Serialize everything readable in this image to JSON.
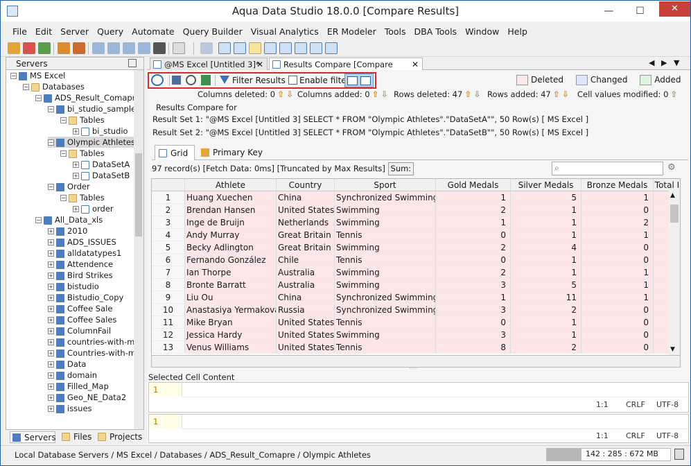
{
  "window": {
    "title": "Aqua Data Studio 18.0.0 [Compare Results]",
    "minimize": "—",
    "maximize": "☐",
    "close": "✕"
  },
  "menu": [
    "File",
    "Edit",
    "Server",
    "Query",
    "Automate",
    "Query Builder",
    "Visual Analytics",
    "ER Modeler",
    "Tools",
    "DBA Tools",
    "Window",
    "Help"
  ],
  "left_panel": {
    "title": "Servers",
    "tree": [
      {
        "label": "MS Excel",
        "depth": 0,
        "icon": "server-icon",
        "exp": "minus"
      },
      {
        "label": "Databases",
        "depth": 1,
        "icon": "folder-icon",
        "exp": "minus"
      },
      {
        "label": "ADS_Result_Comapre",
        "depth": 2,
        "icon": "database-icon",
        "exp": "minus"
      },
      {
        "label": "bi_studio_sample_",
        "depth": 3,
        "icon": "database-icon",
        "exp": "minus"
      },
      {
        "label": "Tables",
        "depth": 4,
        "icon": "folder-icon",
        "exp": "minus"
      },
      {
        "label": "bi_studio",
        "depth": 5,
        "icon": "table-icon",
        "exp": "plus"
      },
      {
        "label": "Olympic Athletes",
        "depth": 3,
        "icon": "database-icon",
        "exp": "minus",
        "selected": true
      },
      {
        "label": "Tables",
        "depth": 4,
        "icon": "folder-icon",
        "exp": "minus"
      },
      {
        "label": "DataSetA",
        "depth": 5,
        "icon": "table-icon",
        "exp": "plus"
      },
      {
        "label": "DataSetB",
        "depth": 5,
        "icon": "table-icon",
        "exp": "plus"
      },
      {
        "label": "Order",
        "depth": 3,
        "icon": "database-icon",
        "exp": "minus"
      },
      {
        "label": "Tables",
        "depth": 4,
        "icon": "folder-icon",
        "exp": "minus"
      },
      {
        "label": "order",
        "depth": 5,
        "icon": "table-icon",
        "exp": "plus"
      },
      {
        "label": "All_Data_xls",
        "depth": 2,
        "icon": "database-icon",
        "exp": "minus"
      },
      {
        "label": "2010",
        "depth": 3,
        "icon": "database-icon",
        "exp": "plus"
      },
      {
        "label": "ADS_ISSUES",
        "depth": 3,
        "icon": "database-icon",
        "exp": "plus"
      },
      {
        "label": "alldatatypes1",
        "depth": 3,
        "icon": "database-icon",
        "exp": "plus"
      },
      {
        "label": "Attendence",
        "depth": 3,
        "icon": "database-icon",
        "exp": "plus"
      },
      {
        "label": "Bird Strikes",
        "depth": 3,
        "icon": "database-icon",
        "exp": "plus"
      },
      {
        "label": "bistudio",
        "depth": 3,
        "icon": "database-icon",
        "exp": "plus"
      },
      {
        "label": "Bistudio_Copy",
        "depth": 3,
        "icon": "database-icon",
        "exp": "plus"
      },
      {
        "label": "Coffee Sale",
        "depth": 3,
        "icon": "database-icon",
        "exp": "plus"
      },
      {
        "label": "Coffee Sales",
        "depth": 3,
        "icon": "database-icon",
        "exp": "plus"
      },
      {
        "label": "ColumnFail",
        "depth": 3,
        "icon": "database-icon",
        "exp": "plus"
      },
      {
        "label": "countries-with-mo",
        "depth": 3,
        "icon": "database-icon",
        "exp": "plus"
      },
      {
        "label": "Countries-with-mo",
        "depth": 3,
        "icon": "database-icon",
        "exp": "plus"
      },
      {
        "label": "Data",
        "depth": 3,
        "icon": "database-icon",
        "exp": "plus"
      },
      {
        "label": "domain",
        "depth": 3,
        "icon": "database-icon",
        "exp": "plus"
      },
      {
        "label": "Filled_Map",
        "depth": 3,
        "icon": "database-icon",
        "exp": "plus"
      },
      {
        "label": "Geo_NE_Data2",
        "depth": 3,
        "icon": "database-icon",
        "exp": "plus"
      },
      {
        "label": "issues",
        "depth": 3,
        "icon": "database-icon",
        "exp": "plus"
      }
    ],
    "bottom_tabs": [
      "Servers",
      "Files",
      "Projects"
    ]
  },
  "doc_tabs": [
    "@MS Excel [Untitled 3]*",
    "Results Compare [Compare Results]"
  ],
  "compare_toolbar": {
    "filter_label": "Filter Results ...",
    "enable_filter": "Enable filter"
  },
  "legend": {
    "deleted": "Deleted",
    "changed": "Changed",
    "added": "Added",
    "deleted_color": "#fde6e6",
    "changed_color": "#dce6fb",
    "added_color": "#dcf5dc"
  },
  "stats": {
    "cols_deleted": "Columns deleted: 0",
    "cols_added": "Columns added: 0",
    "rows_deleted": "Rows deleted: 47",
    "rows_added": "Rows added: 47",
    "cells_modified": "Cell values modified: 0"
  },
  "results_compare": {
    "header": "Results Compare for",
    "set1": "Result Set 1: \"@MS Excel [Untitled 3] SELECT * FROM \"Olympic Athletes\".\"DataSetA\"\", 50 Row(s)  [ MS Excel ]",
    "set2": "Result Set 2: \"@MS Excel [Untitled 3] SELECT * FROM \"Olympic Athletes\".\"DataSetB\"\", 50 Row(s)  [ MS Excel ]"
  },
  "grid_tabs": [
    "Grid",
    "Primary Key"
  ],
  "info": {
    "records": "97 record(s) [Fetch Data: 0ms]  [Truncated by Max Results]",
    "sum": "Sum:"
  },
  "grid": {
    "columns": [
      "Athlete",
      "Country",
      "Sport",
      "Gold Medals",
      "Silver Medals",
      "Bronze Medals",
      "Total I"
    ],
    "rows": [
      [
        "1",
        "Huang Xuechen",
        "China",
        "Synchronized Swimming",
        "1",
        "5",
        "1"
      ],
      [
        "2",
        "Brendan Hansen",
        "United States",
        "Swimming",
        "2",
        "1",
        "0"
      ],
      [
        "3",
        "Inge de Bruijn",
        "Netherlands",
        "Swimming",
        "1",
        "1",
        "2"
      ],
      [
        "4",
        "Andy Murray",
        "Great Britain",
        "Tennis",
        "0",
        "1",
        "1"
      ],
      [
        "5",
        "Becky Adlington",
        "Great Britain",
        "Swimming",
        "2",
        "4",
        "0"
      ],
      [
        "6",
        "Fernando González",
        "Chile",
        "Tennis",
        "0",
        "1",
        "0"
      ],
      [
        "7",
        "Ian Thorpe",
        "Australia",
        "Swimming",
        "2",
        "1",
        "1"
      ],
      [
        "8",
        "Bronte Barratt",
        "Australia",
        "Swimming",
        "3",
        "5",
        "1"
      ],
      [
        "9",
        "Liu Ou",
        "China",
        "Synchronized Swimming",
        "1",
        "11",
        "1"
      ],
      [
        "10",
        "Anastasiya Yermakova",
        "Russia",
        "Synchronized Swimming",
        "3",
        "2",
        "0"
      ],
      [
        "11",
        "Mike Bryan",
        "United States",
        "Tennis",
        "0",
        "1",
        "0"
      ],
      [
        "12",
        "Jessica Hardy",
        "United States",
        "Swimming",
        "3",
        "1",
        "0"
      ],
      [
        "13",
        "Venus Williams",
        "United States",
        "Tennis",
        "8",
        "2",
        "0"
      ]
    ]
  },
  "selected_cell": {
    "label": "Selected Cell Content",
    "line1": "1",
    "line2": "1",
    "pos": "1:1",
    "eol": "CRLF",
    "enc": "UTF-8"
  },
  "statusbar": {
    "path": "Local Database Servers / MS Excel / Databases / ADS_Result_Comapre / Olympic Athletes",
    "memory": "142 : 285 : 672 MB"
  }
}
